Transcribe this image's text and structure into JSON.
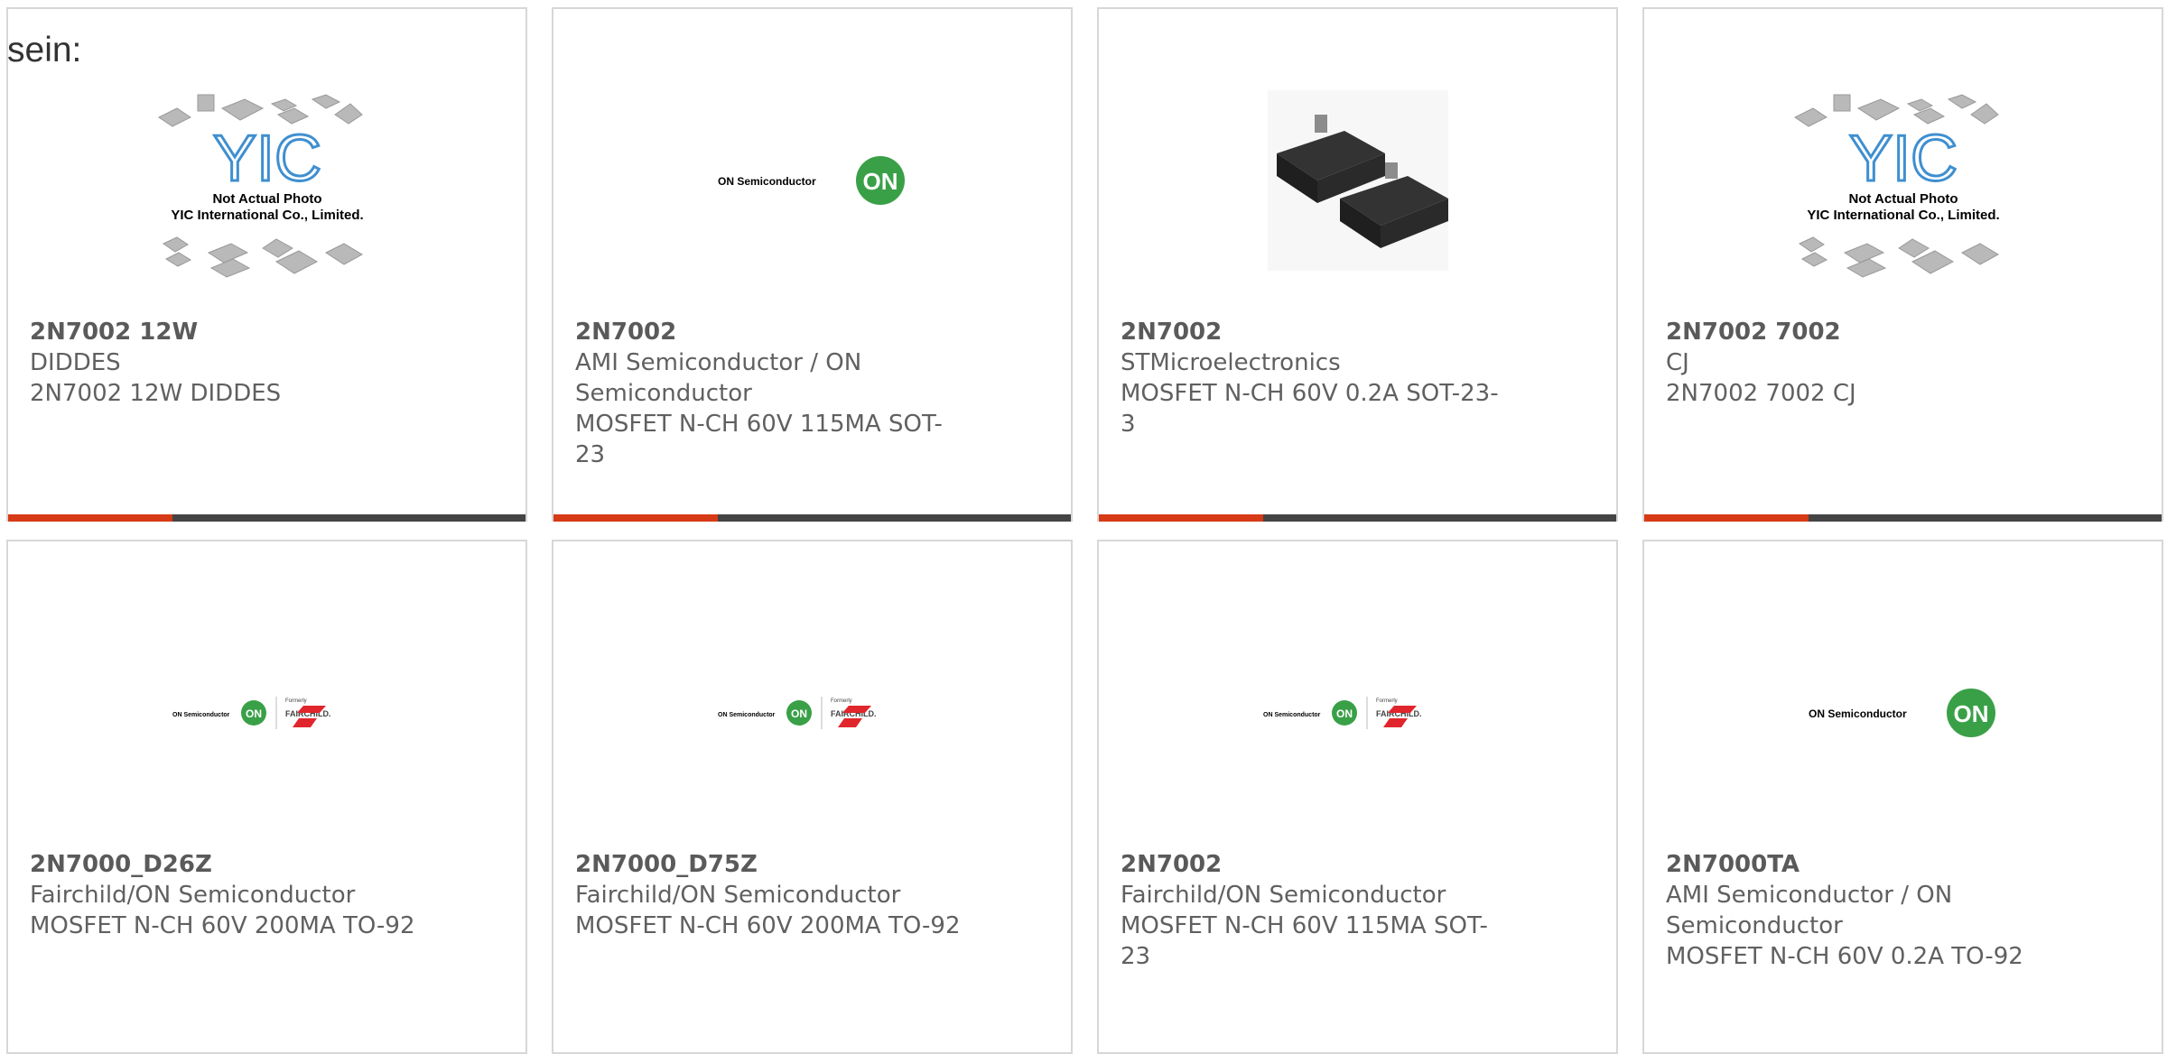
{
  "intro_text": "sein:",
  "placeholder": {
    "line1": "Not Actual Photo",
    "line2": "YIC International Co., Limited."
  },
  "logos": {
    "on_semi": "ON Semiconductor",
    "on_badge": "ON",
    "fairchild_formerly": "Formerly",
    "fairchild": "FAIRCHILD."
  },
  "colors": {
    "accent_red": "#d73a16",
    "accent_dark": "#444444",
    "on_green": "#3aa047",
    "fairchild_red": "#e0262c",
    "yic_blue": "#3f8fd0"
  },
  "products": [
    {
      "part": "2N7002 12W",
      "manufacturer": "DIDDES",
      "description": "2N7002 12W DIDDES",
      "image": "yic-placeholder"
    },
    {
      "part": "2N7002",
      "manufacturer": "AMI Semiconductor / ON Semiconductor",
      "description": "MOSFET N-CH 60V 115MA SOT-23",
      "image": "on-semiconductor-logo"
    },
    {
      "part": "2N7002",
      "manufacturer": "STMicroelectronics",
      "description": "MOSFET N-CH 60V 0.2A SOT-23-3",
      "image": "sot23-chip-photo"
    },
    {
      "part": "2N7002 7002",
      "manufacturer": "CJ",
      "description": "2N7002 7002 CJ",
      "image": "yic-placeholder"
    },
    {
      "part": "2N7000_D26Z",
      "manufacturer": "Fairchild/ON Semiconductor",
      "description": "MOSFET N-CH 60V 200MA TO-92",
      "image": "on-fairchild-logo"
    },
    {
      "part": "2N7000_D75Z",
      "manufacturer": "Fairchild/ON Semiconductor",
      "description": "MOSFET N-CH 60V 200MA TO-92",
      "image": "on-fairchild-logo"
    },
    {
      "part": "2N7002",
      "manufacturer": "Fairchild/ON Semiconductor",
      "description": "MOSFET N-CH 60V 115MA SOT-23",
      "image": "on-fairchild-logo"
    },
    {
      "part": "2N7000TA",
      "manufacturer": "AMI Semiconductor / ON Semiconductor",
      "description": "MOSFET N-CH 60V 0.2A TO-92",
      "image": "on-semiconductor-logo"
    }
  ]
}
